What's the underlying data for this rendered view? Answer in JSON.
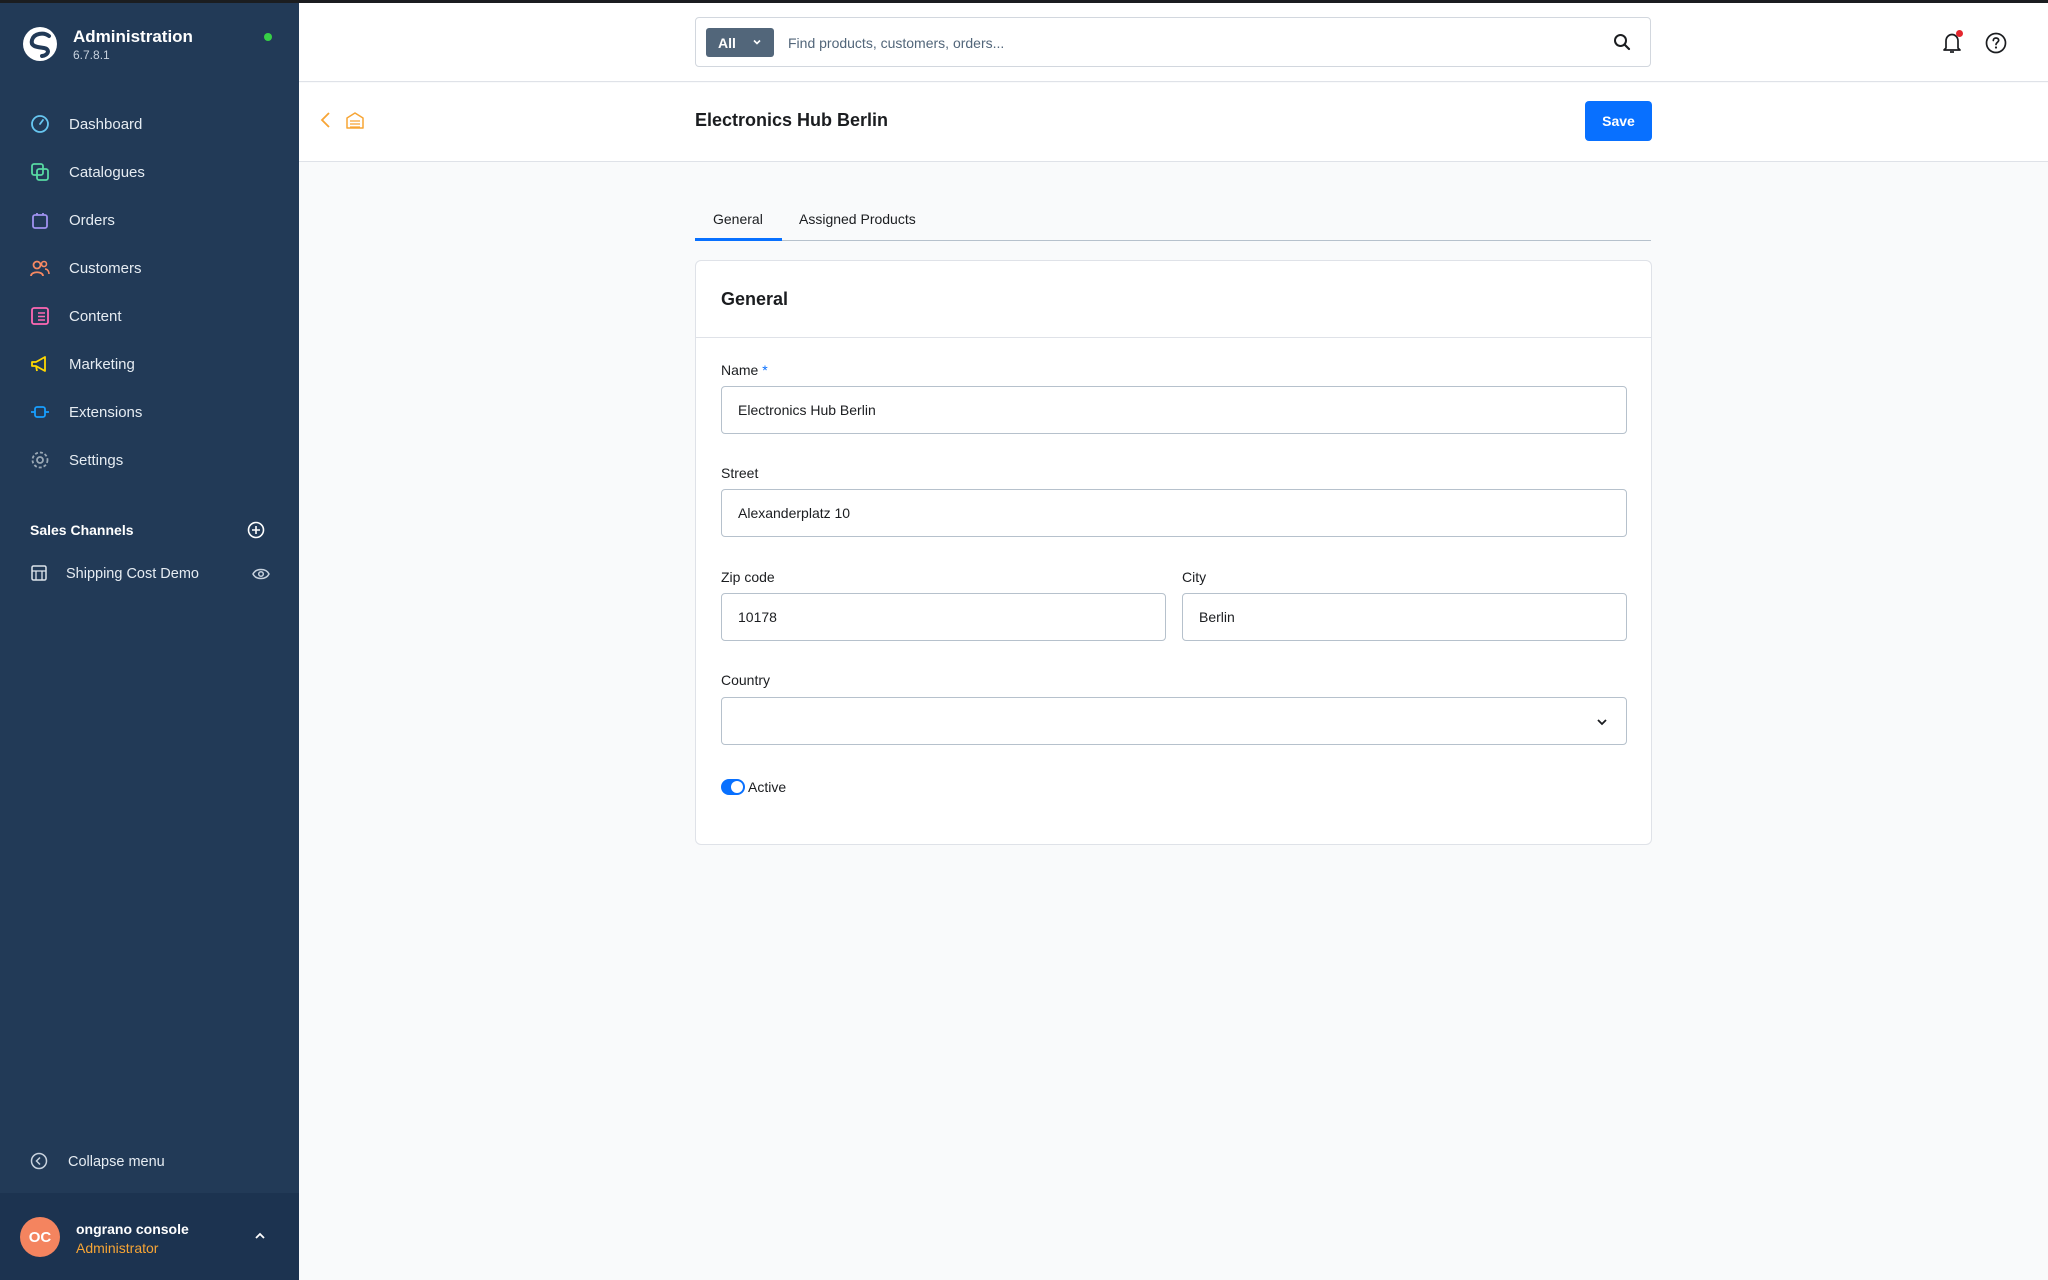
{
  "app": {
    "title": "Administration",
    "version": "6.7.8.1"
  },
  "colors": {
    "sidebar_bg": "#223a57",
    "accent": "#0870ff",
    "status_online": "#37d046",
    "user_role": "#f7a535",
    "avatar_bg": "#f4845f"
  },
  "sidebar": {
    "items": [
      {
        "label": "Dashboard",
        "icon": "dashboard-icon",
        "color": "#67c6f0"
      },
      {
        "label": "Catalogues",
        "icon": "catalogues-icon",
        "color": "#57d9a3"
      },
      {
        "label": "Orders",
        "icon": "orders-icon",
        "color": "#a092f0"
      },
      {
        "label": "Customers",
        "icon": "customers-icon",
        "color": "#f88962"
      },
      {
        "label": "Content",
        "icon": "content-icon",
        "color": "#ff68b4"
      },
      {
        "label": "Marketing",
        "icon": "marketing-icon",
        "color": "#ffd700"
      },
      {
        "label": "Extensions",
        "icon": "extensions-icon",
        "color": "#189eff"
      },
      {
        "label": "Settings",
        "icon": "settings-icon",
        "color": "#9aa8b5"
      }
    ],
    "sales_channels": {
      "heading": "Sales Channels",
      "items": [
        {
          "label": "Shipping Cost Demo",
          "icon": "storefront-icon"
        }
      ]
    },
    "collapse_label": "Collapse menu",
    "user": {
      "initials": "OC",
      "name": "ongrano console",
      "role": "Administrator"
    }
  },
  "search": {
    "type_label": "All",
    "placeholder": "Find products, customers, orders..."
  },
  "page": {
    "title": "Electronics Hub Berlin",
    "save_label": "Save"
  },
  "tabs": [
    {
      "label": "General",
      "active": true
    },
    {
      "label": "Assigned Products",
      "active": false
    }
  ],
  "card": {
    "title": "General",
    "fields": {
      "name": {
        "label": "Name",
        "required_mark": "*",
        "value": "Electronics Hub Berlin"
      },
      "street": {
        "label": "Street",
        "value": "Alexanderplatz 10"
      },
      "zip": {
        "label": "Zip code",
        "value": "10178"
      },
      "city": {
        "label": "City",
        "value": "Berlin"
      },
      "country": {
        "label": "Country",
        "value": ""
      }
    },
    "active": {
      "label": "Active",
      "checked": true
    }
  }
}
